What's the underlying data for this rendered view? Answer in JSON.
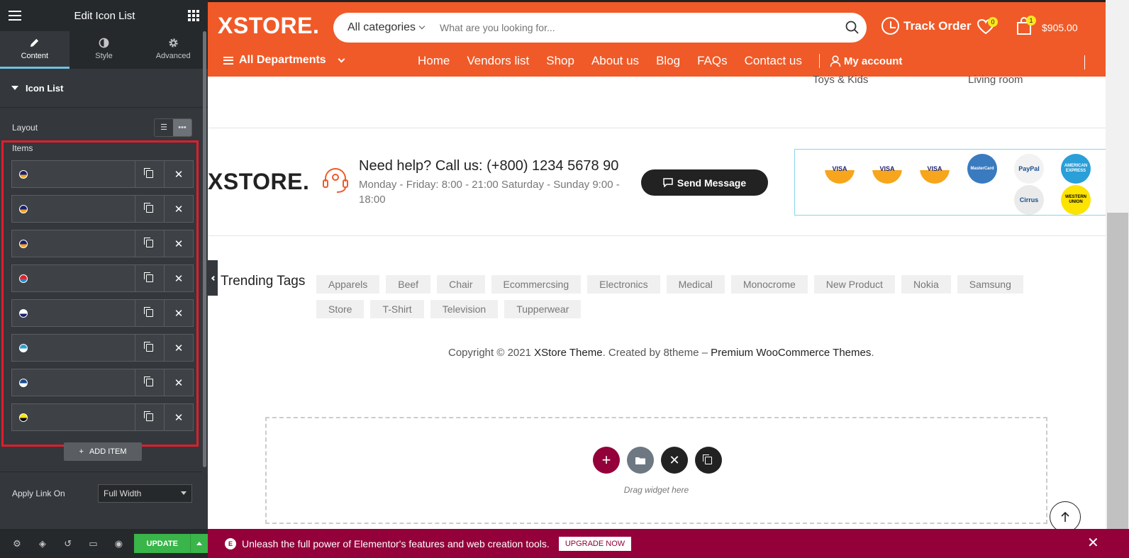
{
  "panel": {
    "title": "Edit Icon List",
    "tabs": [
      {
        "label": "Content",
        "icon": "pencil-icon",
        "active": true
      },
      {
        "label": "Style",
        "icon": "half-circle-icon",
        "active": false
      },
      {
        "label": "Advanced",
        "icon": "gear-icon",
        "active": false
      }
    ],
    "section_title": "Icon List",
    "layout_label": "Layout",
    "layout_options": [
      "list-icon",
      "inline-dots-icon"
    ],
    "items_label": "Items",
    "items": [
      {
        "icon": "visa-mini-icon",
        "color": "#1a1f71",
        "accent": "#f7a51c"
      },
      {
        "icon": "visa-mini-icon",
        "color": "#1a1f71",
        "accent": "#f7a51c"
      },
      {
        "icon": "visa-mini-icon",
        "color": "#1a1f71",
        "accent": "#f7a51c"
      },
      {
        "icon": "mastercard-mini-icon",
        "color": "#ec1c24",
        "accent": "#1a8fd1"
      },
      {
        "icon": "paypal-mini-icon",
        "color": "#ffffff",
        "accent": "#1a1f71"
      },
      {
        "icon": "amex-mini-icon",
        "color": "#2a9fd8",
        "accent": "#ffffff"
      },
      {
        "icon": "cirrus-mini-icon",
        "color": "#1a4d8c",
        "accent": "#ffffff"
      },
      {
        "icon": "western-union-mini-icon",
        "color": "#fce300",
        "accent": "#000000"
      }
    ],
    "add_item_label": "ADD ITEM",
    "apply_link_label": "Apply Link On",
    "apply_link_value": "Full Width",
    "update_label": "UPDATE"
  },
  "site": {
    "logo": "XSTORE.",
    "search": {
      "category": "All categories",
      "placeholder": "What are you looking for..."
    },
    "track_order": "Track Order",
    "wishlist_count": "0",
    "cart_count": "1",
    "cart_total": "$905.00",
    "all_departments": "All Departments",
    "menu": [
      "Home",
      "Vendors list",
      "Shop",
      "About us",
      "Blog",
      "FAQs",
      "Contact us"
    ],
    "my_account": "My account",
    "under_header": [
      "Toys & Kids",
      "Living room"
    ],
    "footer_logo": "XSTORE.",
    "help_title": "Need help? Call us: (+800) 1234 5678 90",
    "help_hours": "Monday - Friday: 8:00 - 21:00 Saturday - Sunday 9:00 - 18:00",
    "send_message": "Send Message",
    "payment_cards": [
      {
        "label": "VISA",
        "top": "#ffffff",
        "bottom": "#f7a51c",
        "text": "#1a1f71"
      },
      {
        "label": "VISA",
        "top": "#ffffff",
        "bottom": "#f7a51c",
        "text": "#1a1f71"
      },
      {
        "label": "VISA",
        "top": "#ffffff",
        "bottom": "#f7a51c",
        "text": "#1a1f71"
      },
      {
        "label": "MasterCard",
        "top": "#3a7bbf",
        "bottom": "#3a7bbf",
        "text": "#ffffff"
      },
      {
        "label": "PayPal",
        "top": "#f2f2f2",
        "bottom": "#f2f2f2",
        "text": "#1a4d8c"
      },
      {
        "label": "AMERICAN EXPRESS",
        "top": "#2a9fd8",
        "bottom": "#2a9fd8",
        "text": "#ffffff"
      },
      {
        "label": "Cirrus",
        "top": "#eaeaea",
        "bottom": "#eaeaea",
        "text": "#1a4d8c"
      },
      {
        "label": "WESTERN UNION",
        "top": "#fce300",
        "bottom": "#fce300",
        "text": "#000000"
      }
    ],
    "tags_title": "Trending Tags",
    "tags": [
      "Apparels",
      "Beef",
      "Chair",
      "Ecommercsing",
      "Electronics",
      "Medical",
      "Monocrome",
      "New Product",
      "Nokia",
      "Samsung",
      "Store",
      "T-Shirt",
      "Television",
      "Tupperwear"
    ],
    "copyright": {
      "prefix": "Copyright © 2021 ",
      "theme": "XStore Theme",
      "middle": ". Created by 8theme – ",
      "link": "Premium WooCommerce Themes",
      "suffix": "."
    },
    "drag_text": "Drag widget here",
    "promo_text": "Unleash the full power of Elementor's features and web creation tools.",
    "upgrade_label": "UPGRADE NOW"
  },
  "colors": {
    "brand_orange": "#f05a28",
    "panel_bg": "#34383c",
    "update_green": "#39b54a",
    "promo": "#93003a",
    "highlight_red": "#e11d2b"
  }
}
